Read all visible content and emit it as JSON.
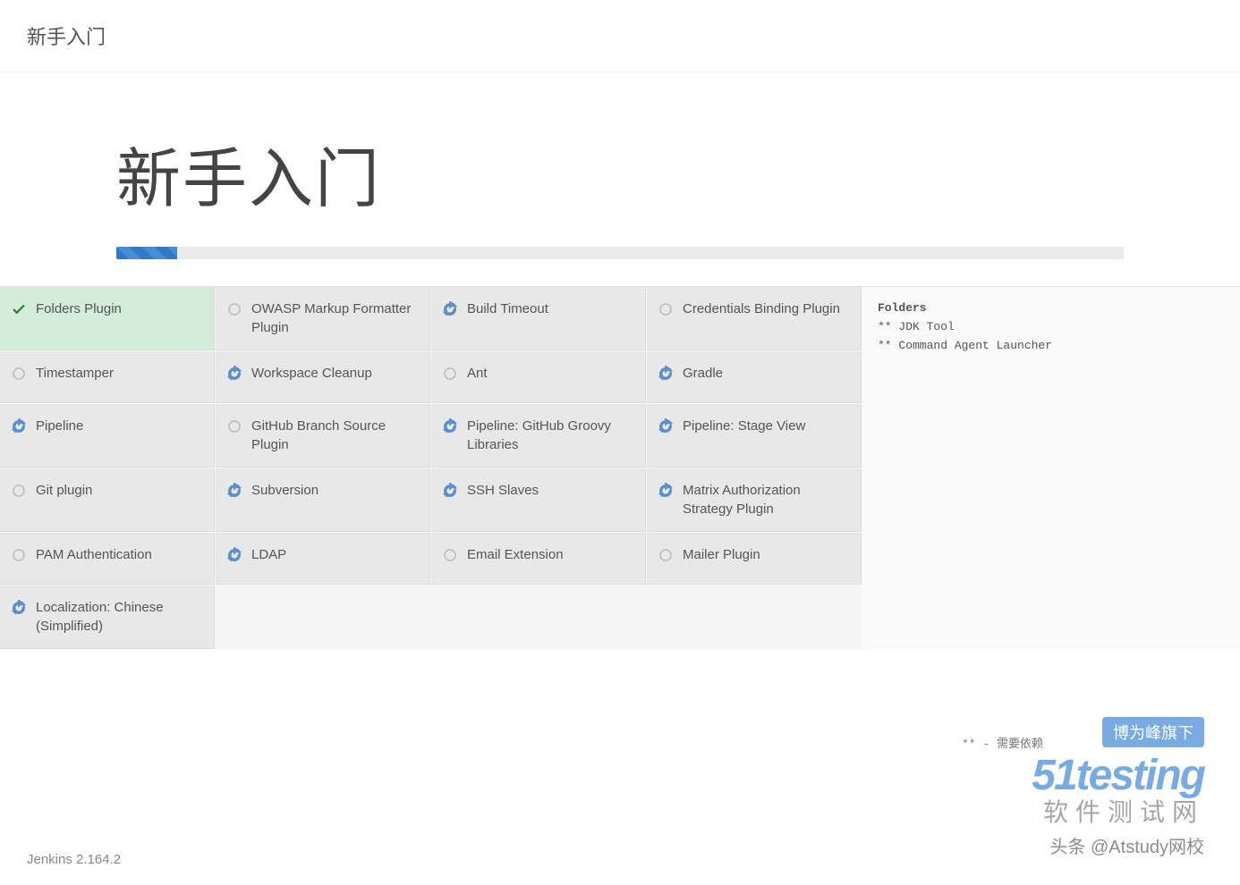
{
  "header": {
    "title": "新手入门"
  },
  "main": {
    "title": "新手入门",
    "progress_percent": 6
  },
  "plugins": [
    {
      "label": "Folders Plugin",
      "status": "success"
    },
    {
      "label": "OWASP Markup Formatter Plugin",
      "status": "pending"
    },
    {
      "label": "Build Timeout",
      "status": "spin"
    },
    {
      "label": "Credentials Binding Plugin",
      "status": "pending"
    },
    {
      "label": "Timestamper",
      "status": "pending"
    },
    {
      "label": "Workspace Cleanup",
      "status": "spin"
    },
    {
      "label": "Ant",
      "status": "pending"
    },
    {
      "label": "Gradle",
      "status": "spin"
    },
    {
      "label": "Pipeline",
      "status": "spin"
    },
    {
      "label": "GitHub Branch Source Plugin",
      "status": "pending"
    },
    {
      "label": "Pipeline: GitHub Groovy Libraries",
      "status": "spin"
    },
    {
      "label": "Pipeline: Stage View",
      "status": "spin"
    },
    {
      "label": "Git plugin",
      "status": "pending"
    },
    {
      "label": "Subversion",
      "status": "spin"
    },
    {
      "label": "SSH Slaves",
      "status": "spin"
    },
    {
      "label": "Matrix Authorization Strategy Plugin",
      "status": "spin"
    },
    {
      "label": "PAM Authentication",
      "status": "pending"
    },
    {
      "label": "LDAP",
      "status": "spin"
    },
    {
      "label": "Email Extension",
      "status": "pending"
    },
    {
      "label": "Mailer Plugin",
      "status": "pending"
    },
    {
      "label": "Localization: Chinese (Simplified)",
      "status": "spin"
    }
  ],
  "sidepanel": {
    "title": "Folders",
    "deps": [
      "** JDK Tool",
      "** Command Agent Launcher"
    ]
  },
  "dep_hint": "** - 需要依赖",
  "footer": {
    "version": "Jenkins 2.164.2"
  },
  "watermark": {
    "badge": "博为峰旗下",
    "logo": "51testing",
    "sub": "软件测试网",
    "attr": "头条 @Atstudy网校"
  }
}
